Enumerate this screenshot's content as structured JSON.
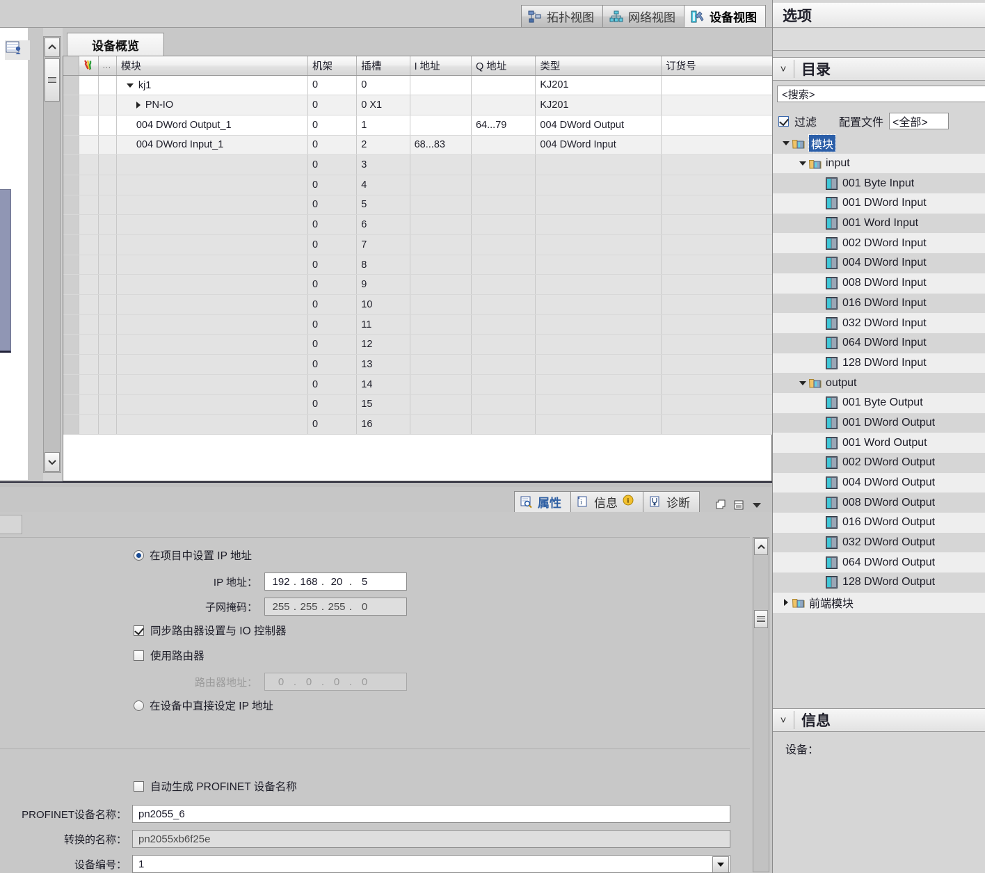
{
  "view_tabs": [
    {
      "label": "拓扑视图",
      "icon": "topology-icon",
      "active": false
    },
    {
      "label": "网络视图",
      "icon": "network-icon",
      "active": false
    },
    {
      "label": "设备视图",
      "icon": "device-icon",
      "active": true
    }
  ],
  "device_overview": {
    "tab_label": "设备概览",
    "columns": [
      {
        "key": "mark",
        "label": "",
        "icon": "wrench-icon"
      },
      {
        "key": "dots",
        "label": "..."
      },
      {
        "key": "module",
        "label": "模块"
      },
      {
        "key": "rack",
        "label": "机架"
      },
      {
        "key": "slot",
        "label": "插槽"
      },
      {
        "key": "iaddr",
        "label": "I 地址"
      },
      {
        "key": "qaddr",
        "label": "Q 地址"
      },
      {
        "key": "type",
        "label": "类型"
      },
      {
        "key": "order",
        "label": "订货号"
      }
    ],
    "rows": [
      {
        "module": "kj1",
        "rack": "0",
        "slot": "0",
        "iaddr": "",
        "qaddr": "",
        "type": "KJ201",
        "order": "",
        "indent": 1,
        "twisty": "down"
      },
      {
        "module": "PN-IO",
        "rack": "0",
        "slot": "0 X1",
        "iaddr": "",
        "qaddr": "",
        "type": "KJ201",
        "order": "",
        "indent": 2,
        "twisty": "right"
      },
      {
        "module": "004 DWord Output_1",
        "rack": "0",
        "slot": "1",
        "iaddr": "",
        "qaddr": "64...79",
        "type": "004 DWord Output",
        "order": "",
        "indent": 3,
        "twisty": "none"
      },
      {
        "module": "004 DWord Input_1",
        "rack": "0",
        "slot": "2",
        "iaddr": "68...83",
        "qaddr": "",
        "type": "004 DWord Input",
        "order": "",
        "indent": 3,
        "twisty": "none"
      },
      {
        "module": "",
        "rack": "0",
        "slot": "3",
        "iaddr": "",
        "qaddr": "",
        "type": "",
        "order": "",
        "indent": 0,
        "twisty": "none"
      },
      {
        "module": "",
        "rack": "0",
        "slot": "4",
        "iaddr": "",
        "qaddr": "",
        "type": "",
        "order": "",
        "indent": 0,
        "twisty": "none"
      },
      {
        "module": "",
        "rack": "0",
        "slot": "5",
        "iaddr": "",
        "qaddr": "",
        "type": "",
        "order": "",
        "indent": 0,
        "twisty": "none"
      },
      {
        "module": "",
        "rack": "0",
        "slot": "6",
        "iaddr": "",
        "qaddr": "",
        "type": "",
        "order": "",
        "indent": 0,
        "twisty": "none"
      },
      {
        "module": "",
        "rack": "0",
        "slot": "7",
        "iaddr": "",
        "qaddr": "",
        "type": "",
        "order": "",
        "indent": 0,
        "twisty": "none"
      },
      {
        "module": "",
        "rack": "0",
        "slot": "8",
        "iaddr": "",
        "qaddr": "",
        "type": "",
        "order": "",
        "indent": 0,
        "twisty": "none"
      },
      {
        "module": "",
        "rack": "0",
        "slot": "9",
        "iaddr": "",
        "qaddr": "",
        "type": "",
        "order": "",
        "indent": 0,
        "twisty": "none"
      },
      {
        "module": "",
        "rack": "0",
        "slot": "10",
        "iaddr": "",
        "qaddr": "",
        "type": "",
        "order": "",
        "indent": 0,
        "twisty": "none"
      },
      {
        "module": "",
        "rack": "0",
        "slot": "11",
        "iaddr": "",
        "qaddr": "",
        "type": "",
        "order": "",
        "indent": 0,
        "twisty": "none"
      },
      {
        "module": "",
        "rack": "0",
        "slot": "12",
        "iaddr": "",
        "qaddr": "",
        "type": "",
        "order": "",
        "indent": 0,
        "twisty": "none"
      },
      {
        "module": "",
        "rack": "0",
        "slot": "13",
        "iaddr": "",
        "qaddr": "",
        "type": "",
        "order": "",
        "indent": 0,
        "twisty": "none"
      },
      {
        "module": "",
        "rack": "0",
        "slot": "14",
        "iaddr": "",
        "qaddr": "",
        "type": "",
        "order": "",
        "indent": 0,
        "twisty": "none"
      },
      {
        "module": "",
        "rack": "0",
        "slot": "15",
        "iaddr": "",
        "qaddr": "",
        "type": "",
        "order": "",
        "indent": 0,
        "twisty": "none"
      },
      {
        "module": "",
        "rack": "0",
        "slot": "16",
        "iaddr": "",
        "qaddr": "",
        "type": "",
        "order": "",
        "indent": 0,
        "twisty": "none"
      }
    ]
  },
  "property_tabs": [
    {
      "label": "属性",
      "icon": "properties-icon",
      "active": true,
      "badge": ""
    },
    {
      "label": "信息",
      "icon": "info-icon",
      "active": false,
      "badge": "i"
    },
    {
      "label": "诊断",
      "icon": "diagnostics-icon",
      "active": false,
      "badge": ""
    }
  ],
  "ip_section": {
    "radio_project_label": "在项目中设置 IP 地址",
    "radio_project_selected": true,
    "ip_label": "IP 地址：",
    "ip_value": [
      "192",
      "168",
      "20",
      "5"
    ],
    "subnet_label": "子网掩码：",
    "subnet_value": [
      "255",
      "255",
      "255",
      "0"
    ],
    "sync_router_label": "同步路由器设置与 IO 控制器",
    "sync_router_checked": true,
    "use_router_label": "使用路由器",
    "use_router_checked": false,
    "router_addr_label": "路由器地址：",
    "router_addr_value": [
      "0",
      "0",
      "0",
      "0"
    ],
    "radio_device_label": "在设备中直接设定 IP 地址",
    "radio_device_selected": false
  },
  "profinet_section": {
    "auto_gen_label": "自动生成 PROFINET 设备名称",
    "auto_gen_checked": false,
    "device_name_label": "PROFINET设备名称：",
    "device_name_value": "pn2055_6",
    "converted_name_label": "转换的名称：",
    "converted_name_value": "pn2055xb6f25e",
    "device_number_label": "设备编号：",
    "device_number_value": "1"
  },
  "task_card": {
    "title": "选项",
    "catalog": {
      "header": "目录",
      "search_placeholder": "<搜索>",
      "filter_label": "过滤",
      "filter_checked": true,
      "profile_label": "配置文件",
      "profile_value": "<全部>",
      "tree": [
        {
          "label": "模块",
          "depth": 0,
          "type": "folder",
          "twisty": "down",
          "selected": true
        },
        {
          "label": "input",
          "depth": 1,
          "type": "folder",
          "twisty": "down",
          "selected": false
        },
        {
          "label": "001 Byte Input",
          "depth": 2,
          "type": "module",
          "twisty": "none",
          "selected": false
        },
        {
          "label": "001 DWord Input",
          "depth": 2,
          "type": "module",
          "twisty": "none",
          "selected": false
        },
        {
          "label": "001 Word Input",
          "depth": 2,
          "type": "module",
          "twisty": "none",
          "selected": false
        },
        {
          "label": "002 DWord Input",
          "depth": 2,
          "type": "module",
          "twisty": "none",
          "selected": false
        },
        {
          "label": "004 DWord Input",
          "depth": 2,
          "type": "module",
          "twisty": "none",
          "selected": false
        },
        {
          "label": "008 DWord Input",
          "depth": 2,
          "type": "module",
          "twisty": "none",
          "selected": false
        },
        {
          "label": "016 DWord Input",
          "depth": 2,
          "type": "module",
          "twisty": "none",
          "selected": false
        },
        {
          "label": "032 DWord Input",
          "depth": 2,
          "type": "module",
          "twisty": "none",
          "selected": false
        },
        {
          "label": "064 DWord Input",
          "depth": 2,
          "type": "module",
          "twisty": "none",
          "selected": false
        },
        {
          "label": "128 DWord Input",
          "depth": 2,
          "type": "module",
          "twisty": "none",
          "selected": false
        },
        {
          "label": "output",
          "depth": 1,
          "type": "folder",
          "twisty": "down",
          "selected": false
        },
        {
          "label": "001 Byte Output",
          "depth": 2,
          "type": "module",
          "twisty": "none",
          "selected": false
        },
        {
          "label": "001 DWord Output",
          "depth": 2,
          "type": "module",
          "twisty": "none",
          "selected": false
        },
        {
          "label": "001 Word Output",
          "depth": 2,
          "type": "module",
          "twisty": "none",
          "selected": false
        },
        {
          "label": "002 DWord Output",
          "depth": 2,
          "type": "module",
          "twisty": "none",
          "selected": false
        },
        {
          "label": "004 DWord Output",
          "depth": 2,
          "type": "module",
          "twisty": "none",
          "selected": false
        },
        {
          "label": "008 DWord Output",
          "depth": 2,
          "type": "module",
          "twisty": "none",
          "selected": false
        },
        {
          "label": "016 DWord Output",
          "depth": 2,
          "type": "module",
          "twisty": "none",
          "selected": false
        },
        {
          "label": "032 DWord Output",
          "depth": 2,
          "type": "module",
          "twisty": "none",
          "selected": false
        },
        {
          "label": "064 DWord Output",
          "depth": 2,
          "type": "module",
          "twisty": "none",
          "selected": false
        },
        {
          "label": "128 DWord Output",
          "depth": 2,
          "type": "module",
          "twisty": "none",
          "selected": false
        },
        {
          "label": "前端模块",
          "depth": 0,
          "type": "folder",
          "twisty": "right",
          "selected": false
        }
      ]
    },
    "info": {
      "header": "信息",
      "device_label": "设备："
    }
  },
  "colors": {
    "accent_blue": "#2e5fa3",
    "selection_blue": "#2b5ea8",
    "module_icon_cyan": "#3fc8d8",
    "folder_yellow": "#e8b84b"
  }
}
